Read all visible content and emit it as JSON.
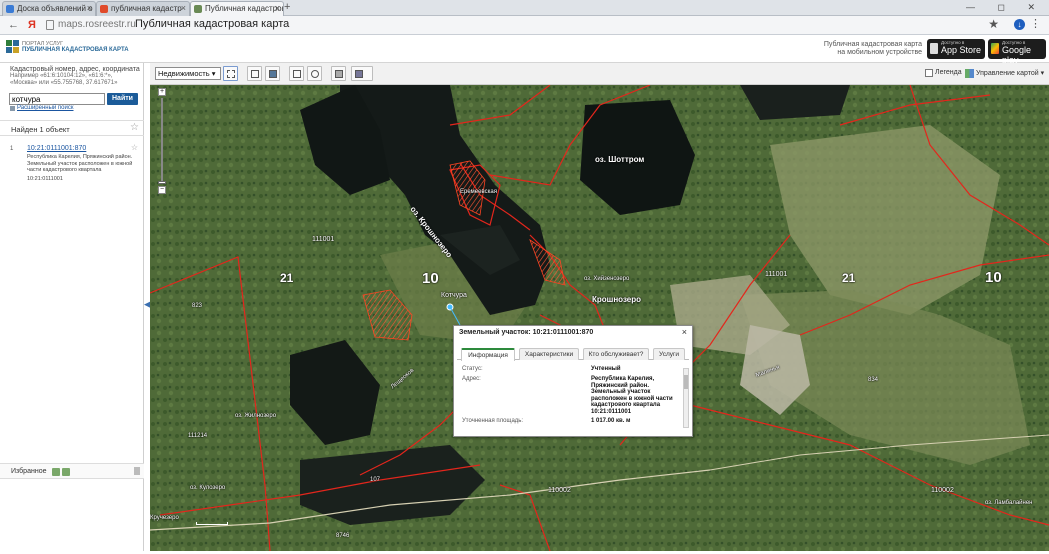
{
  "browser": {
    "tabs": [
      {
        "label": "Доска объявлений о",
        "favicon_color": "#3a7bd5"
      },
      {
        "label": "публичная кадастр",
        "favicon_color": "#e04a2a"
      },
      {
        "label": "Публичная кадастров",
        "favicon_color": "#6a8a55"
      }
    ],
    "new_tab_symbol": "+",
    "window_controls": "— ◻ ✕",
    "back": "←",
    "yandex_logo": "Я",
    "url": "maps.rosreestr.ru",
    "page_title": "Публичная кадастровая карта",
    "bookmark_star": "★",
    "download_glyph": "↓",
    "menu_glyph": "⋮"
  },
  "header": {
    "portal_small": "ПОРТАЛ УСЛУГ",
    "portal_title": "ПУБЛИЧНАЯ КАДАСТРОВАЯ КАРТА",
    "mobile_line1": "Публичная кадастровая карта",
    "mobile_line2": "на мобильном устройстве",
    "appstore_small": "Доступно в",
    "appstore": "App Store",
    "googleplay_small": "Доступно в",
    "googleplay": "Google play"
  },
  "left_panel": {
    "hint_title": "Кадастровый номер, адрес, координата",
    "hint_example1": "Например «61:6:10104:12», «61:6:*»,",
    "hint_example2": "«Москва» или «55.755768, 37.617671»",
    "search_value": "котчура",
    "find_button": "Найти",
    "advanced_search": "Расширенный поиск",
    "found_label": "Найден 1 объект",
    "result": {
      "index": "1",
      "cadastral_link": "10:21:0111001:870",
      "description": "Республика Карелия, Пряжинский район. Земельный участок расположен в южной части кадастрового квартала",
      "quarter": "10:21:0111001"
    },
    "favorites_label": "Избранное",
    "collapse_glyph": "◀"
  },
  "toolbar": {
    "realty_select": "Недвижимость",
    "legend_label": "Легенда",
    "map_management": "Управление картой"
  },
  "map": {
    "zoom_plus": "+",
    "zoom_minus": "−",
    "labels": {
      "lake_shotozero": "оз. Шоттром",
      "lake_krushnozero": "оз. Крошнозеро",
      "village_krushnozero": "Крошнозеро",
      "kotchura": "Котчура",
      "village_top": "Еремеевская",
      "lake_small_right": "оз. Хийзенозеро",
      "lake_zhirnozero": "оз. Жилнозеро",
      "lake_kulozero": "оз. Кулозеро",
      "lake_ambyalambi": "оз. Ламбалайнен",
      "big10_left": "10",
      "big21_left": "21",
      "big21_right": "21",
      "big10_right": "10",
      "q111001_left": "111001",
      "q111001_right": "111001",
      "q110002_mid": "110002",
      "q110002_right": "110002",
      "q_left_bottom": "111214",
      "kruchezero": "Кручезеро",
      "road_left": "Лещеоков",
      "road_right": "Малинья",
      "n_823": "823",
      "n_834": "834",
      "n_107": "107",
      "n_8746": "8746"
    }
  },
  "popup": {
    "title": "Земельный участок: 10:21:0111001:870",
    "close": "×",
    "tabs": [
      "Информация",
      "Характеристики",
      "Кто обслуживает?",
      "Услуги"
    ],
    "status_label": "Статус:",
    "status_value": "Учтенный",
    "address_label": "Адрес:",
    "address_value": "Республика Карелия, Пряжинский район. Земельный участок расположен в южной части кадастрового квартала 10:21:0111001",
    "area_label": "Уточненная площадь:",
    "area_value": "1 017.00 кв. м"
  }
}
